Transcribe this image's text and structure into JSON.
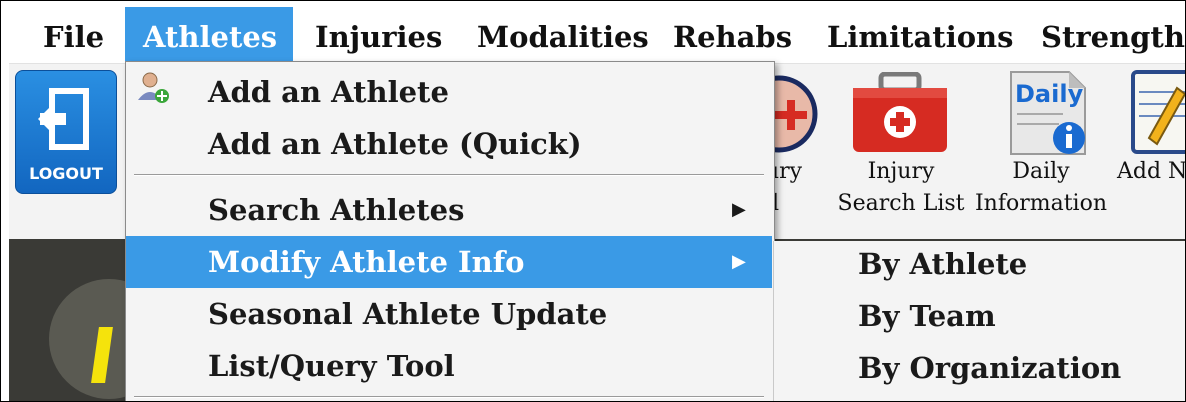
{
  "menubar": {
    "items": [
      {
        "label": "File"
      },
      {
        "label": "Athletes"
      },
      {
        "label": "Injuries"
      },
      {
        "label": "Modalities"
      },
      {
        "label": "Rehabs"
      },
      {
        "label": "Limitations"
      },
      {
        "label": "Strength"
      }
    ],
    "active": "Athletes"
  },
  "toolbar": {
    "logout_label": "LOGOUT",
    "buttons": [
      {
        "line1": "ury",
        "line2": "d"
      },
      {
        "line1": "Injury",
        "line2": "Search List"
      },
      {
        "line1": "Daily",
        "line2": "Information",
        "icon_text": "Daily"
      },
      {
        "line1": "Add N",
        "line2": ""
      }
    ]
  },
  "dropdown": {
    "items": [
      {
        "label": "Add an Athlete"
      },
      {
        "label": "Add an Athlete (Quick)"
      },
      {
        "label": "Search Athletes"
      },
      {
        "label": "Modify Athlete Info"
      },
      {
        "label": "Seasonal Athlete Update"
      },
      {
        "label": "List/Query Tool"
      }
    ],
    "highlighted": "Modify Athlete Info"
  },
  "submenu": {
    "items": [
      {
        "label": "By Athlete"
      },
      {
        "label": "By Team"
      },
      {
        "label": "By Organization"
      }
    ]
  },
  "colors": {
    "highlight": "#3a9ae6",
    "logout_blue": "#1a7ad4",
    "first_aid_red": "#d62b22"
  }
}
